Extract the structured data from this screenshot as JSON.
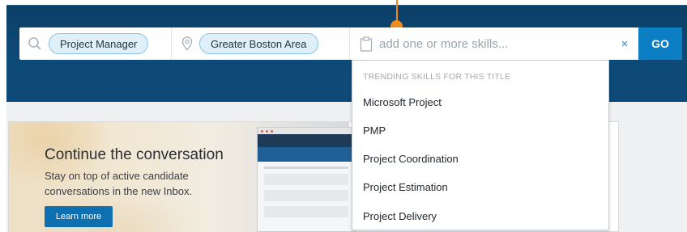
{
  "search": {
    "title_chip": "Project Manager",
    "location_chip": "Greater Boston Area",
    "skills_placeholder": "add one or more skills...",
    "clear_label": "×",
    "go_label": "GO"
  },
  "dropdown": {
    "heading": "TRENDING SKILLS FOR THIS TITLE",
    "items": [
      "Microsoft Project",
      "PMP",
      "Project Coordination",
      "Project Estimation",
      "Project Delivery"
    ]
  },
  "banner": {
    "title": "Continue the conversation",
    "subtitle": "Stay on top of active candidate conversations in the new Inbox.",
    "button": "Learn more"
  },
  "colors": {
    "navy": "#0d4a79",
    "go_button": "#0b7ec4",
    "chip_fill": "#dff0fb",
    "marker": "#f08a1a"
  },
  "icons": {
    "title_segment": "search-icon",
    "location_segment": "location-pin-icon",
    "skills_segment": "clipboard-icon",
    "clear": "close-icon"
  }
}
